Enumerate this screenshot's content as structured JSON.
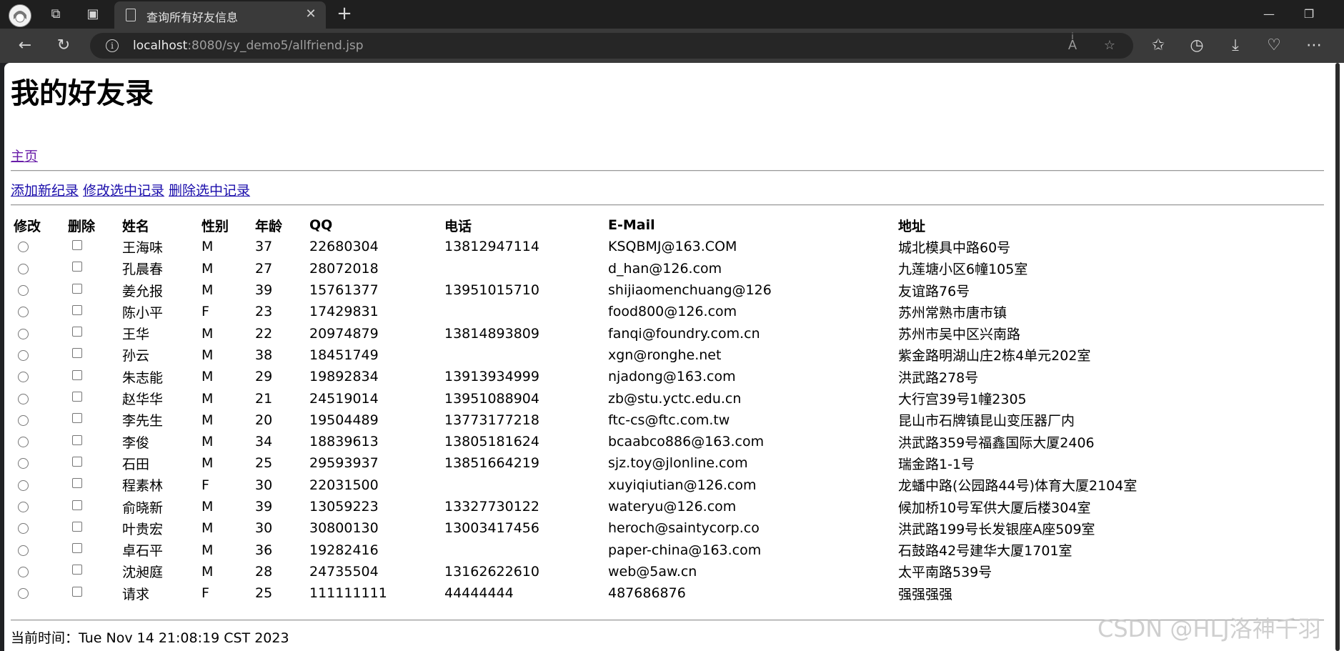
{
  "browser": {
    "tab_title": "查询所有好友信息",
    "url_host": "localhost",
    "url_path": ":8080/sy_demo5/allfriend.jsp",
    "window_controls": {
      "minimize": "—",
      "restore": "❐",
      "close": "✕"
    }
  },
  "page": {
    "heading": "我的好友录",
    "home_link": "主页",
    "actions": {
      "add": "添加新纪录",
      "edit": "修改选中记录",
      "delete": "删除选中记录"
    },
    "table": {
      "headers": [
        "修改",
        "删除",
        "姓名",
        "性别",
        "年龄",
        "QQ",
        "电话",
        "E-Mail",
        "地址"
      ],
      "rows": [
        {
          "name": "王海味",
          "sex": "M",
          "age": "37",
          "qq": "22680304",
          "phone": "13812947114",
          "email": "KSQBMJ@163.COM",
          "address": "城北模具中路60号"
        },
        {
          "name": "孔晨春",
          "sex": "M",
          "age": "27",
          "qq": "28072018",
          "phone": "",
          "email": "d_han@126.com",
          "address": "九莲塘小区6幢105室"
        },
        {
          "name": "姜允报",
          "sex": "M",
          "age": "39",
          "qq": "15761377",
          "phone": "13951015710",
          "email": "shijiaomenchuang@126",
          "address": "友谊路76号"
        },
        {
          "name": "陈小平",
          "sex": "F",
          "age": "23",
          "qq": "17429831",
          "phone": "",
          "email": "food800@126.com",
          "address": "苏州常熟市唐市镇"
        },
        {
          "name": "王华",
          "sex": "M",
          "age": "22",
          "qq": "20974879",
          "phone": "13814893809",
          "email": "fanqi@foundry.com.cn",
          "address": "苏州市吴中区兴南路"
        },
        {
          "name": "孙云",
          "sex": "M",
          "age": "38",
          "qq": "18451749",
          "phone": "",
          "email": "xgn@ronghe.net",
          "address": "紫金路明湖山庄2栋4单元202室"
        },
        {
          "name": "朱志能",
          "sex": "M",
          "age": "29",
          "qq": "19892834",
          "phone": "13913934999",
          "email": "njadong@163.com",
          "address": "洪武路278号"
        },
        {
          "name": "赵华华",
          "sex": "M",
          "age": "21",
          "qq": "24519014",
          "phone": "13951088904",
          "email": "zb@stu.yctc.edu.cn",
          "address": "大行宫39号1幢2305"
        },
        {
          "name": "李先生",
          "sex": "M",
          "age": "20",
          "qq": "19504489",
          "phone": "13773177218",
          "email": "ftc-cs@ftc.com.tw",
          "address": "昆山市石牌镇昆山变压器厂内"
        },
        {
          "name": "李俊",
          "sex": "M",
          "age": "34",
          "qq": "18839613",
          "phone": "13805181624",
          "email": "bcaabco886@163.com",
          "address": "洪武路359号福鑫国际大厦2406"
        },
        {
          "name": "石田",
          "sex": "M",
          "age": "25",
          "qq": "29593937",
          "phone": "13851664219",
          "email": "sjz.toy@jlonline.com",
          "address": "瑞金路1-1号"
        },
        {
          "name": "程素林",
          "sex": "F",
          "age": "30",
          "qq": "22031500",
          "phone": "",
          "email": "xuyiqiutian@126.com",
          "address": "龙蟠中路(公园路44号)体育大厦2104室"
        },
        {
          "name": "俞晓新",
          "sex": "M",
          "age": "39",
          "qq": "13059223",
          "phone": "13327730122",
          "email": "wateryu@126.com",
          "address": "候加桥10号军供大厦后楼304室"
        },
        {
          "name": "叶贵宏",
          "sex": "M",
          "age": "30",
          "qq": "30800130",
          "phone": "13003417456",
          "email": "heroch@saintycorp.co",
          "address": "洪武路199号长发银座A座509室"
        },
        {
          "name": "卓石平",
          "sex": "M",
          "age": "36",
          "qq": "19282416",
          "phone": "",
          "email": "paper-china@163.com",
          "address": "石鼓路42号建华大厦1701室"
        },
        {
          "name": "沈昶庭",
          "sex": "M",
          "age": "28",
          "qq": "24735504",
          "phone": "13162622610",
          "email": "web@5aw.cn",
          "address": "太平南路539号"
        },
        {
          "name": "请求",
          "sex": "F",
          "age": "25",
          "qq": "111111111",
          "phone": "44444444",
          "email": "487686876",
          "address": "强强强强"
        }
      ]
    },
    "footer_label": "当前时间：",
    "footer_time": "Tue Nov 14 21:08:19 CST 2023",
    "watermark": "CSDN @HLJ洛神千羽"
  }
}
